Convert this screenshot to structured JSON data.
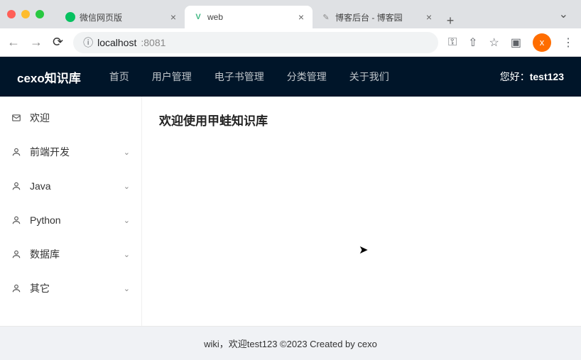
{
  "browser": {
    "tabs": [
      {
        "title": "微信网页版",
        "favicon_color": "#07c160"
      },
      {
        "title": "web",
        "favicon_color": "#41b883"
      },
      {
        "title": "博客后台 - 博客园",
        "favicon_color": "#888"
      }
    ],
    "url_host": "localhost",
    "url_port": ":8081",
    "avatar_letter": "x"
  },
  "header": {
    "brand": "cexo知识库",
    "nav": [
      "首页",
      "用户管理",
      "电子书管理",
      "分类管理",
      "关于我们"
    ],
    "greeting_prefix": "您好：",
    "username": "test123"
  },
  "sidebar": {
    "items": [
      {
        "label": "欢迎",
        "icon": "mail",
        "expandable": false
      },
      {
        "label": "前端开发",
        "icon": "user",
        "expandable": true
      },
      {
        "label": "Java",
        "icon": "user",
        "expandable": true
      },
      {
        "label": "Python",
        "icon": "user",
        "expandable": true
      },
      {
        "label": "数据库",
        "icon": "user",
        "expandable": true
      },
      {
        "label": "其它",
        "icon": "user",
        "expandable": true
      }
    ]
  },
  "content": {
    "heading": "欢迎使用甲蛙知识库"
  },
  "footer": {
    "text": "wiki，欢迎test123 ©2023 Created by cexo"
  }
}
